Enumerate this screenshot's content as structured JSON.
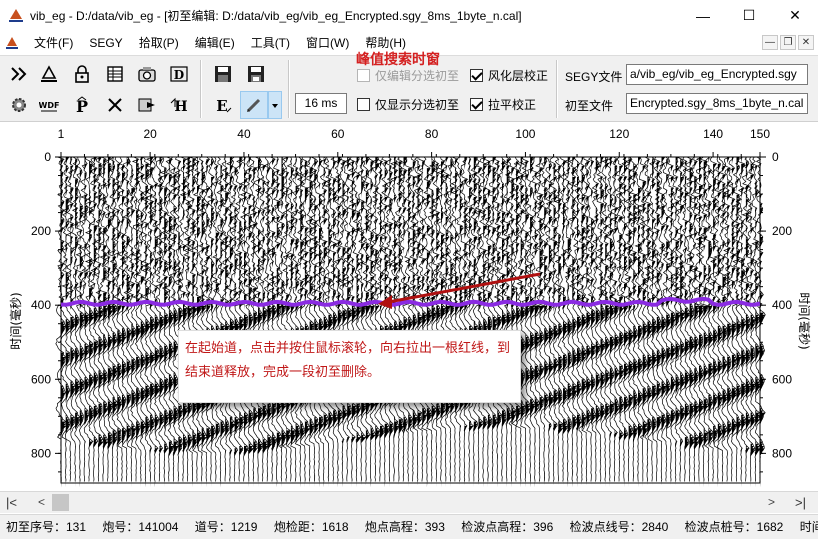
{
  "window": {
    "title": "vib_eg - D:/data/vib_eg - [初至编辑: D:/data/vib_eg/vib_eg_Encrypted.sgy_8ms_1byte_n.cal]",
    "minimize": "—",
    "maximize": "☐",
    "close": "✕"
  },
  "menu": {
    "items": [
      "文件(F)",
      "SEGY",
      "拾取(P)",
      "编辑(E)",
      "工具(T)",
      "窗口(W)",
      "帮助(H)"
    ],
    "mdi_min": "—",
    "mdi_restore": "❐",
    "mdi_close": "✕"
  },
  "toolbar": {
    "peak_window_label": "峰值搜索时窗",
    "peak_window_value": "16 ms",
    "only_edit_split": "仅编辑分选初至",
    "only_show_split": "仅显示分选初至",
    "weathering_correction": "风化层校正",
    "flatten_correction": "拉平校正",
    "segy_file_label": "SEGY文件",
    "segy_file_value": "a/vib_eg/vib_eg_Encrypted.sgy",
    "firstbreak_file_label": "初至文件",
    "firstbreak_file_value": "Encrypted.sgy_8ms_1byte_n.cal",
    "icons": [
      "fast-forward-icon",
      "pick-icon",
      "lock-icon",
      "table-icon",
      "camera-icon",
      "d-icon",
      "save-icon",
      "save-as-icon",
      "gear-icon",
      "wdf-icon",
      "p-icon",
      "x-arrows-icon",
      "export-icon",
      "h-icon",
      "e-icon",
      "pencil-icon",
      "dropdown-icon"
    ]
  },
  "plot": {
    "callout_text": "在起始道，点击并按住鼠标滚轮，向右拉出一根红线，到结束道释放，完成一段初至删除。",
    "x_ticks": [
      "1",
      "20",
      "40",
      "60",
      "80",
      "100",
      "120",
      "140",
      "150"
    ],
    "y_ticks": [
      "0",
      "200",
      "400",
      "600",
      "800"
    ],
    "y_label": "时间(毫秒)",
    "pick_color": "#8a2be2",
    "arrow_color": "#b01010"
  },
  "scrollbar": {
    "left_end": "|<",
    "left_arrow": "<",
    "right_arrow": ">",
    "right_end": ">|"
  },
  "status": {
    "items": [
      "初至序号：131",
      "炮号：141004",
      "道号：1219",
      "炮检距：1618",
      "炮点高程：393",
      "检波点高程：396",
      "检波点线号：2840",
      "检波点桩号：1682",
      "时间"
    ]
  }
}
